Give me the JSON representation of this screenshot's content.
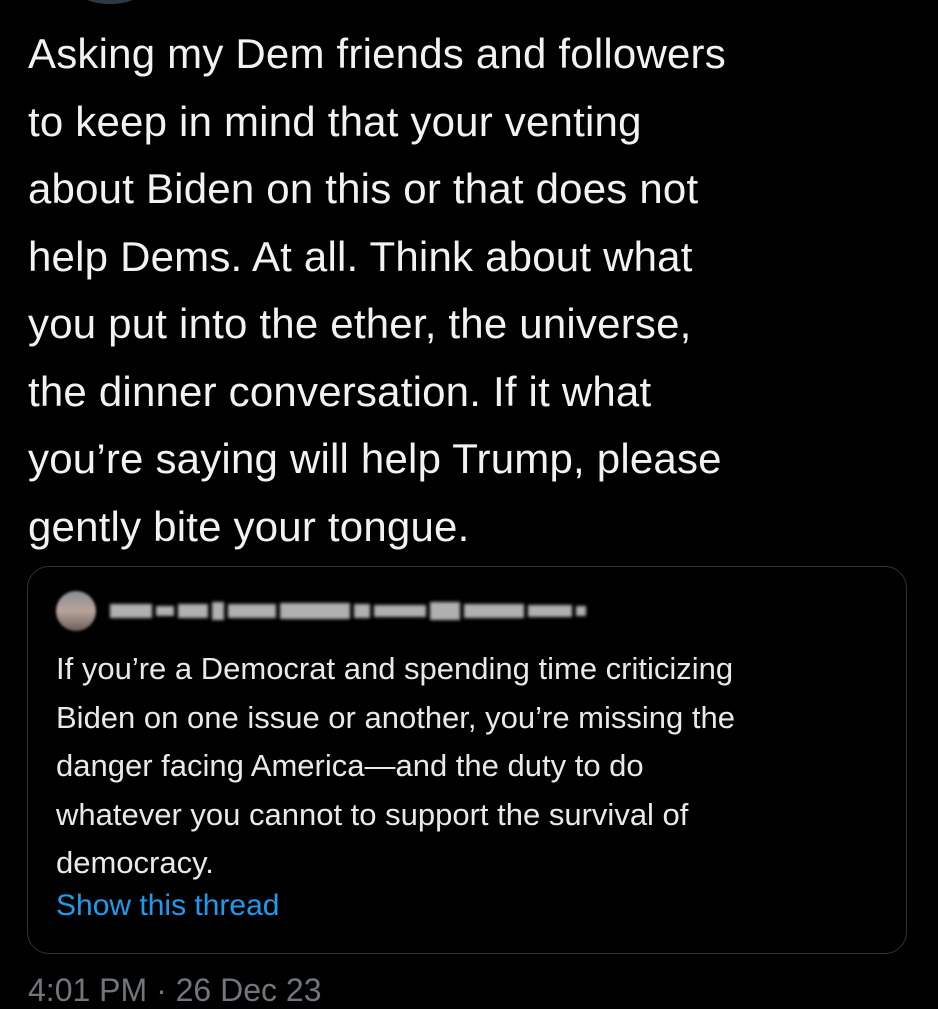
{
  "tweet": {
    "text": "Asking my Dem friends and followers\nto keep in mind that your venting\nabout Biden on this or that does not\nhelp Dems. At all. Think about what\nyou put into the ether, the universe,\nthe dinner conversation. If it what\nyou’re saying will help Trump, please\ngently bite your tongue.",
    "timestamp": "4:01 PM · 26 Dec 23"
  },
  "quoted_tweet": {
    "text": "If you’re a Democrat and spending time criticizing\nBiden on one issue or another, you’re missing the\ndanger facing America—and the duty to do\nwhatever you cannot to support the survival of\ndemocracy.",
    "show_thread_label": "Show this thread",
    "author_redacted": true
  },
  "colors": {
    "background": "#000000",
    "text": "#e7e9ea",
    "link": "#1d9bf0",
    "secondary": "#71767b",
    "border": "#2f3336"
  }
}
